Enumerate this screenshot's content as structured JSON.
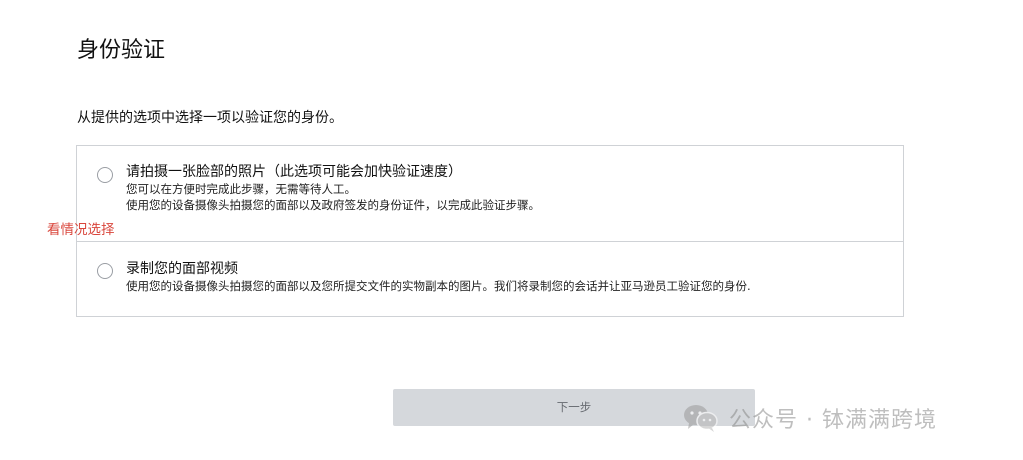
{
  "page": {
    "title": "身份验证",
    "instruction": "从提供的选项中选择一项以验证您的身份。"
  },
  "options": [
    {
      "title": "请拍摄一张脸部的照片（此选项可能会加快验证速度）",
      "description_lines": [
        "您可以在方便时完成此步骤，无需等待人工。",
        "使用您的设备摄像头拍摄您的面部以及政府签发的身份证件，以完成此验证步骤。"
      ],
      "selected": false
    },
    {
      "title": "录制您的面部视频",
      "description_lines": [
        "使用您的设备摄像头拍摄您的面部以及您所提交文件的实物副本的图片。我们将录制您的会话并让亚马逊员工验证您的身份."
      ],
      "selected": false
    }
  ],
  "annotation": "看情况选择",
  "buttons": {
    "next_label": "下一步"
  },
  "watermark": {
    "icon": "wechat-icon",
    "text": "公众号 · 钵满满跨境"
  },
  "colors": {
    "annotation": "#d9453b",
    "button_bg": "#d5d8dc",
    "border": "#cfd2d6"
  }
}
